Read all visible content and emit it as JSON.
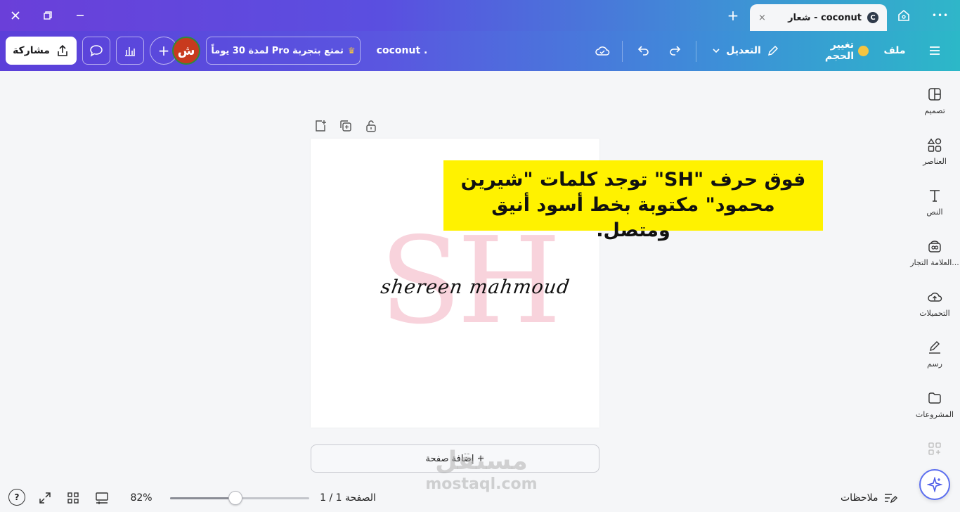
{
  "window": {
    "tab_title": "coconut - شعار",
    "tab_logo": "C",
    "tab_close": "×",
    "new_tab": "+",
    "home_icon": "home-icon",
    "more": "•••"
  },
  "toolbar": {
    "menu_icon": "hamburger-icon",
    "file_label": "ملف",
    "resize_label": "تغيير الحجم",
    "edit_label": "التعديل",
    "doc_title": "coconut .",
    "pro_trial_label": "تمتع بتجربة Pro لمدة 30 يوماً",
    "avatar_initial": "ش",
    "add_label": "+",
    "share_label": "مشاركة"
  },
  "sidebar": {
    "items": [
      {
        "label": "تصميم",
        "icon": "layout-icon"
      },
      {
        "label": "العناصر",
        "icon": "shapes-icon"
      },
      {
        "label": "النص",
        "icon": "text-icon"
      },
      {
        "label": "العلامة التجار...",
        "icon": "brand-icon"
      },
      {
        "label": "التحميلات",
        "icon": "upload-cloud-icon"
      },
      {
        "label": "رسم",
        "icon": "draw-icon"
      },
      {
        "label": "المشروعات",
        "icon": "folder-icon"
      }
    ]
  },
  "canvas": {
    "logo_letters": "SH",
    "script_text": "shereen mahmoud",
    "caption": "فوق حرف \"SH\" توجد كلمات \"شيرين محمود\" مكتوبة بخط أسود أنيق ومتصل.",
    "add_page": "+ إضافة صفحة"
  },
  "watermark": {
    "arabic": "مستقل",
    "latin": "mostaql.com"
  },
  "bottom": {
    "notes_label": "ملاحظات",
    "page_label": "الصفحة 1 / 1",
    "zoom_label": "82%",
    "zoom_fraction": 0.47,
    "help": "?"
  },
  "colors": {
    "accent": "#5b3fd9",
    "accent_end": "#2cb8c8",
    "caption_bg": "#fff200",
    "logo_pink": "#f8d3dc"
  }
}
